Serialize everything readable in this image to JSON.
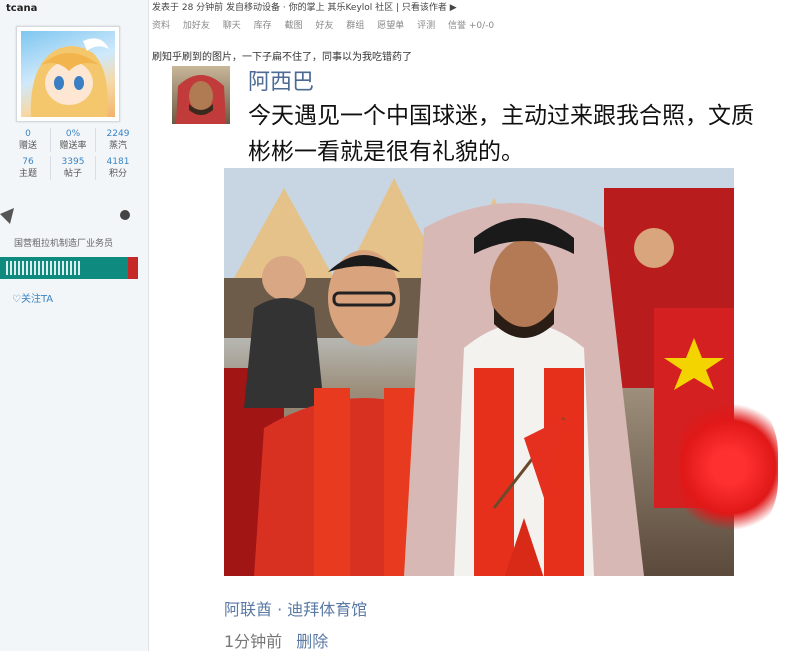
{
  "sidebar": {
    "username": "tcana",
    "stats_row1": [
      {
        "value": "0",
        "label": "赠送"
      },
      {
        "value": "0%",
        "label": "赠送率"
      },
      {
        "value": "2249",
        "label": "蒸汽"
      }
    ],
    "stats_row2": [
      {
        "value": "76",
        "label": "主题"
      },
      {
        "value": "3395",
        "label": "帖子"
      },
      {
        "value": "4181",
        "label": "积分"
      }
    ],
    "user_title": "国营粗拉机制造厂业务员",
    "follow_label": "♡关注TA"
  },
  "post_header": {
    "topline": "发表于 28 分钟前  发自移动设备 · 你的掌上 其乐Keylol 社区  |  只看该作者 ▶",
    "toolbar": [
      "资料",
      "加好友",
      "聊天",
      "库存",
      "截图",
      "好友",
      "群组",
      "愿望单",
      "评测",
      "信誉 +0/-0"
    ],
    "caption": "刷知乎刷到的图片，一下子扁不住了，同事以为我吃错药了"
  },
  "screenshot_post": {
    "author": "阿西巴",
    "text": "今天遇见一个中国球迷，主动过来跟我合照，文质彬彬一看就是很有礼貌的。",
    "location": "阿联酋 · 迪拜体育馆",
    "time": "1分钟前",
    "delete_label": "删除"
  }
}
